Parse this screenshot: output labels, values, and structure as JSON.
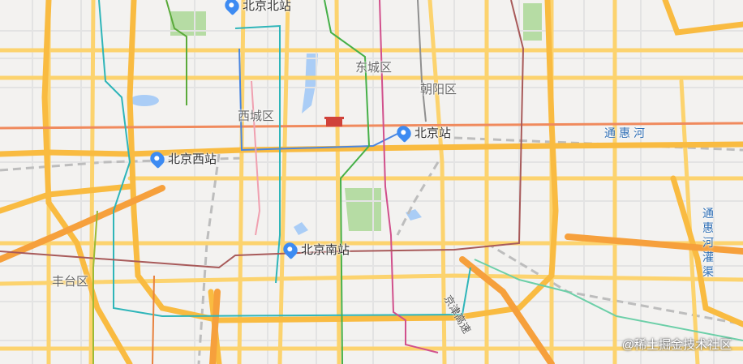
{
  "districts": {
    "dongcheng": "东城区",
    "xicheng": "西城区",
    "chaoyang": "朝阳区",
    "fengtai": "丰台区"
  },
  "stations": {
    "north": "北京北站",
    "main": "北京站",
    "west": "北京西站",
    "south": "北京南站"
  },
  "waterways": {
    "tonghui_river": "通惠河",
    "tonghui_canal": "通惠河灌渠"
  },
  "highways": {
    "jingjintang": "京津高速"
  },
  "watermark": "@稀土掘金技术社区"
}
